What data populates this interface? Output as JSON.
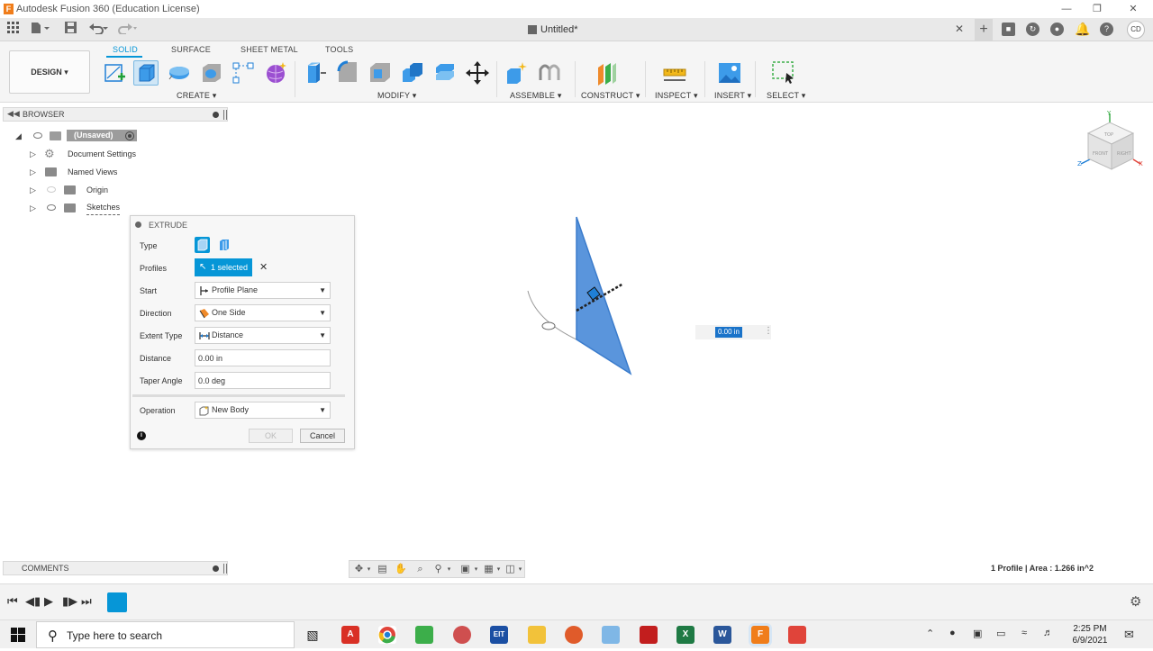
{
  "window": {
    "title": "Autodesk Fusion 360 (Education License)",
    "app_icon_letter": "F"
  },
  "document": {
    "title": "Untitled*"
  },
  "ribbon": {
    "workspace_label": "DESIGN",
    "tabs": [
      "SOLID",
      "SURFACE",
      "SHEET METAL",
      "TOOLS"
    ],
    "active_tab": "SOLID",
    "groups": [
      "CREATE",
      "MODIFY",
      "ASSEMBLE",
      "CONSTRUCT",
      "INSPECT",
      "INSERT",
      "SELECT"
    ]
  },
  "browser": {
    "title": "BROWSER",
    "root": "(Unsaved)",
    "items": [
      "Document Settings",
      "Named Views",
      "Origin",
      "Sketches"
    ]
  },
  "extrude": {
    "title": "EXTRUDE",
    "labels": {
      "type": "Type",
      "profiles": "Profiles",
      "start": "Start",
      "direction": "Direction",
      "extent_type": "Extent Type",
      "distance": "Distance",
      "taper_angle": "Taper Angle",
      "operation": "Operation"
    },
    "profiles_value": "1 selected",
    "start_value": "Profile Plane",
    "direction_value": "One Side",
    "extent_type_value": "Distance",
    "distance_value": "0.00 in",
    "taper_value": "0.0 deg",
    "operation_value": "New Body",
    "ok_label": "OK",
    "cancel_label": "Cancel"
  },
  "viewport": {
    "distance_input": "0.00 in",
    "viewcube_faces": [
      "TOP",
      "FRONT",
      "RIGHT"
    ],
    "axes": [
      "Y",
      "Z",
      "X"
    ]
  },
  "comments": {
    "title": "COMMENTS"
  },
  "status": {
    "text": "1 Profile | Area : 1.266 in^2"
  },
  "taskbar": {
    "search_placeholder": "Type here to search",
    "time": "2:25 PM",
    "date": "6/9/2021",
    "apps": [
      "A",
      "",
      "",
      "",
      "EIT",
      "",
      "",
      "",
      "",
      "X",
      "W",
      "F",
      ""
    ]
  },
  "colors": {
    "accent": "#0696d7",
    "profile_fill": "#5a95dc",
    "fusion_orange": "#f07d1a"
  },
  "icons": {
    "title": [
      "fusion-app-icon",
      "minimize-icon",
      "restore-icon",
      "close-icon"
    ],
    "quick_access": [
      "grid-icon",
      "file-icon",
      "save-icon",
      "undo-icon",
      "redo-icon"
    ],
    "right": [
      "job-status-icon",
      "extensions-icon",
      "notifications-icon",
      "help-icon"
    ]
  }
}
